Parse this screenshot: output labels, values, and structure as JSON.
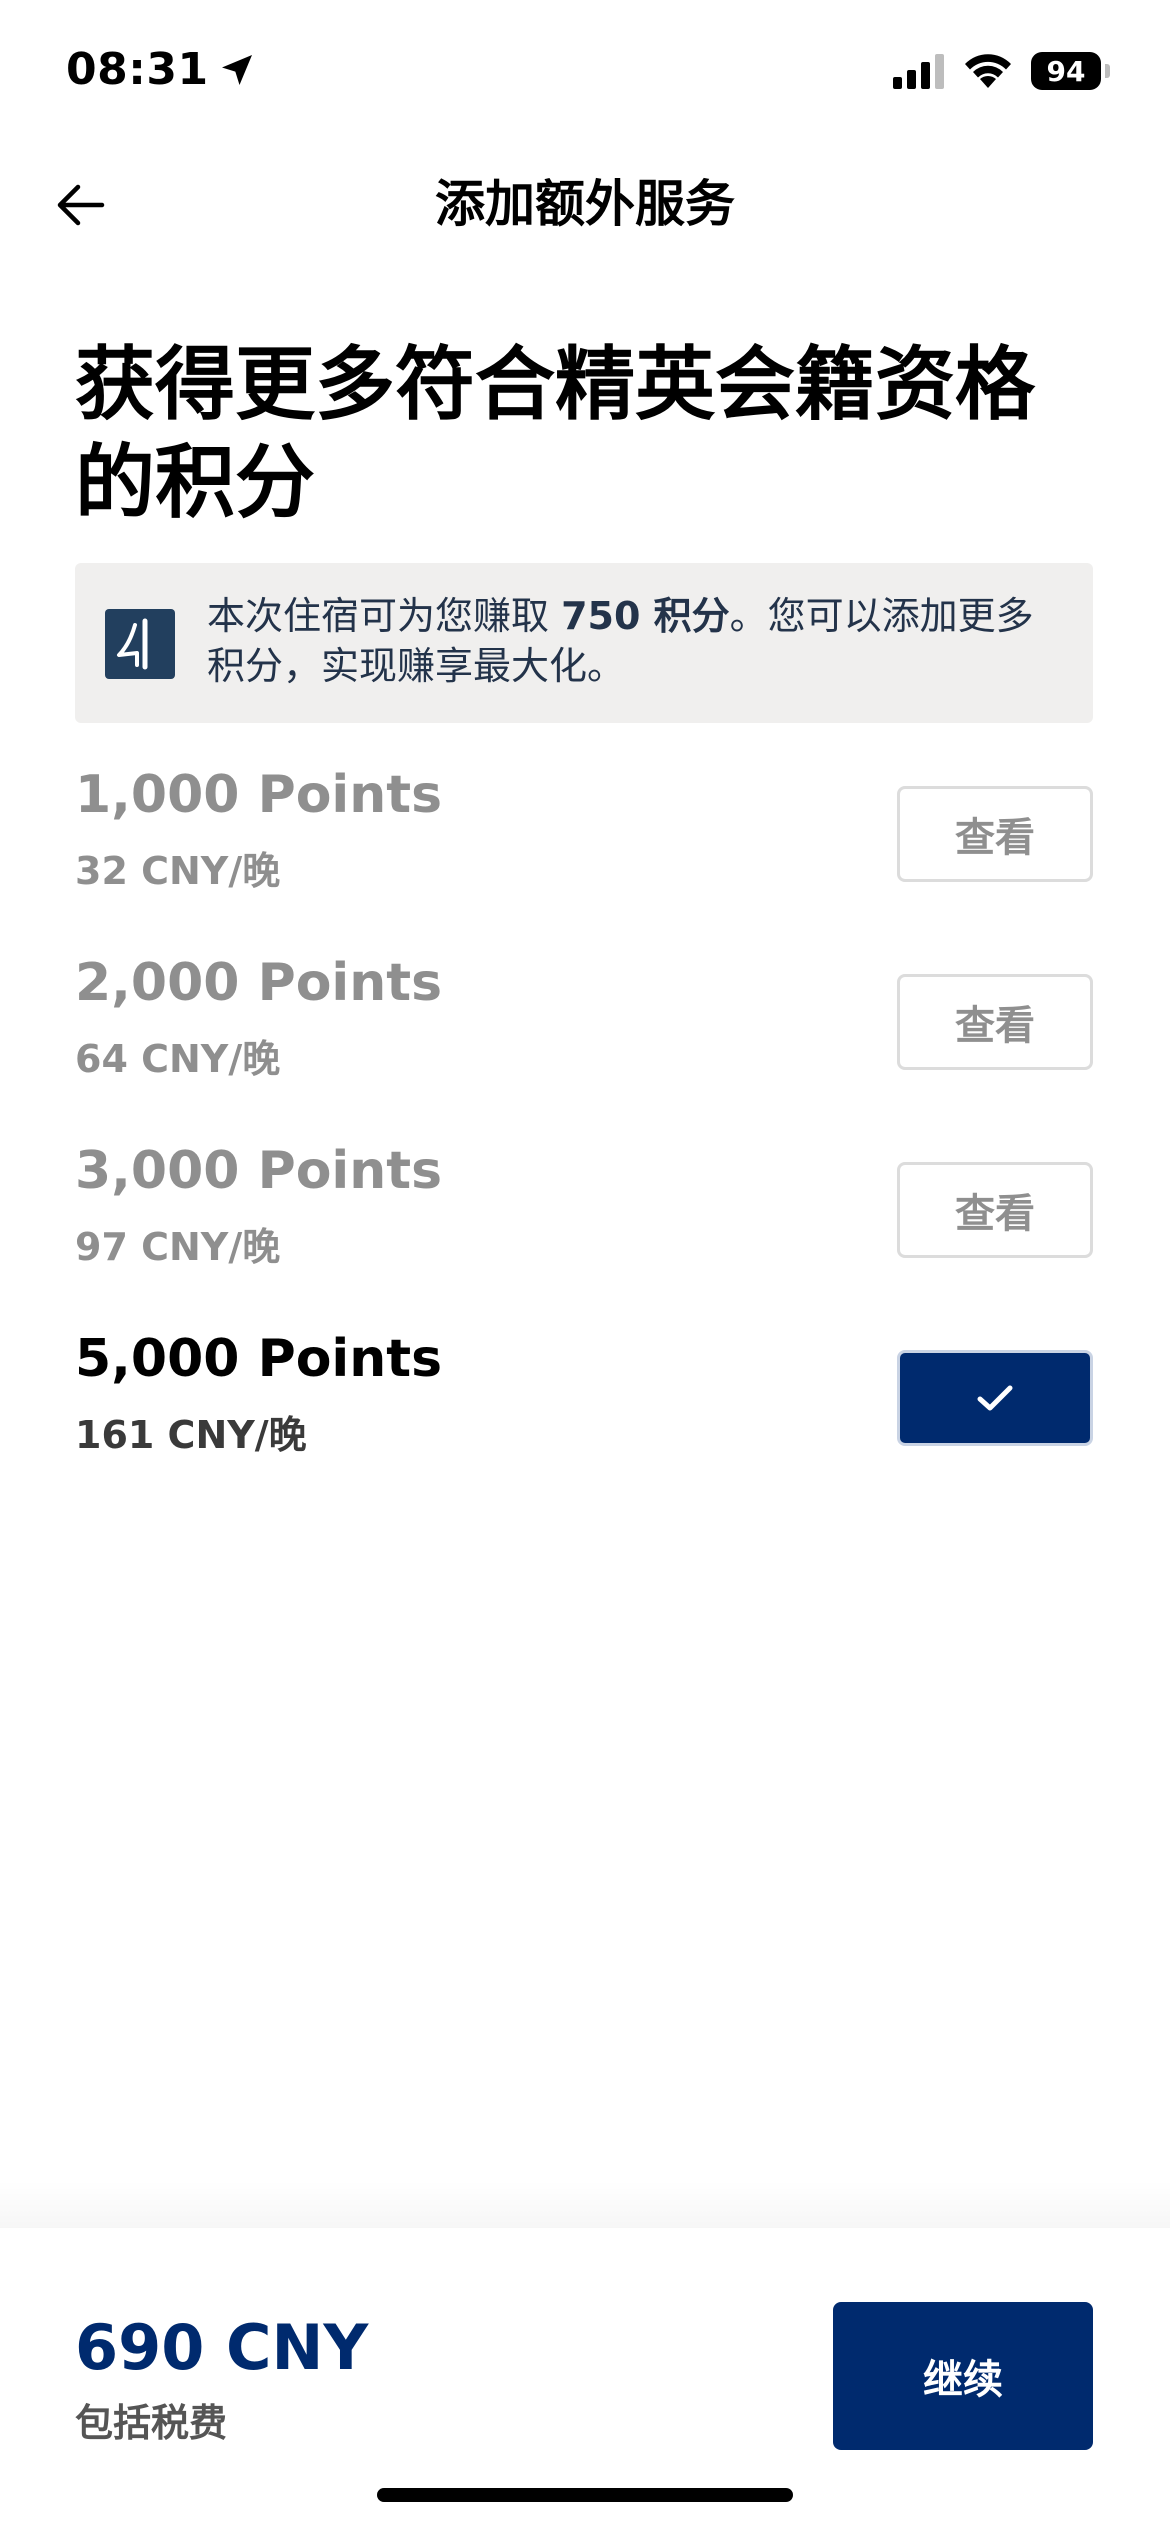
{
  "status_bar": {
    "time": "08:31",
    "battery": "94"
  },
  "nav": {
    "title": "添加额外服务"
  },
  "heading": {
    "line1": "获得更多符合精英会籍资格",
    "line2": "的积分"
  },
  "info_banner": {
    "text_before": "本次住宿可为您赚取 ",
    "points_highlight": "750 积分",
    "text_after": "。您可以添加更多积分，实现赚享最大化。"
  },
  "options": [
    {
      "name": "1,000 Points",
      "price": "32 CNY/晚",
      "action": "查看",
      "selected": false
    },
    {
      "name": "2,000 Points",
      "price": "64 CNY/晚",
      "action": "查看",
      "selected": false
    },
    {
      "name": "3,000 Points",
      "price": "97 CNY/晚",
      "action": "查看",
      "selected": false
    },
    {
      "name": "5,000 Points",
      "price": "161 CNY/晚",
      "action": "",
      "selected": true
    }
  ],
  "footer": {
    "total": "690 CNY",
    "tax_note": "包括税费",
    "continue_label": "继续"
  },
  "colors": {
    "brand_navy": "#002a6e",
    "banner_bg": "#f0efee",
    "dim_text": "#8f8f8f"
  }
}
